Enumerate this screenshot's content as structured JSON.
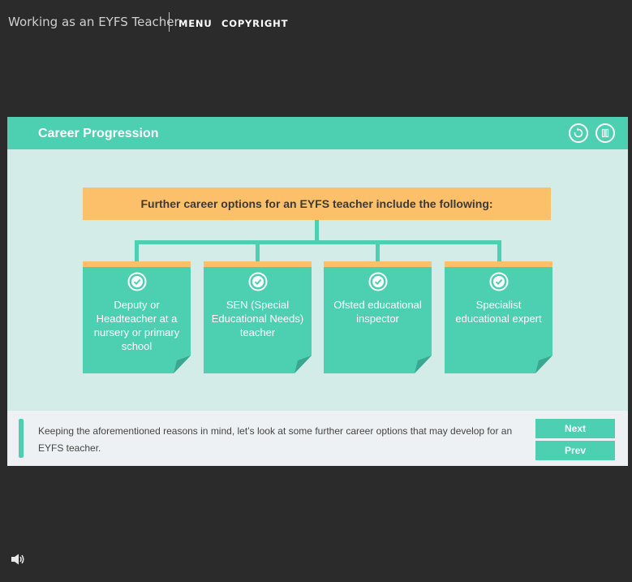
{
  "header": {
    "app_title": "Working as an EYFS Teacher",
    "menu_label": "MENU",
    "copyright_label": "COPYRIGHT"
  },
  "slide": {
    "title": "Career Progression",
    "controls": {
      "replay_icon": "replay-icon",
      "pause_icon": "pause-icon"
    },
    "main_box": "Further career options for an EYFS teacher include the following:",
    "cards": [
      {
        "label": "Deputy or\nHeadteacher at   a\nnursery or primary\nschool",
        "icon": "check-icon"
      },
      {
        "label": "SEN (Special\nEducational Needs)\nteacher",
        "icon": "check-icon"
      },
      {
        "label": "Ofsted educational\ninspector",
        "icon": "check-icon"
      },
      {
        "label": "Specialist\neducational expert",
        "icon": "check-icon"
      }
    ],
    "footer_text": "Keeping the aforementioned reasons in mind, let’s look at some further career options that may develop for an EYFS teacher.",
    "next_label": "Next",
    "prev_label": "Prev"
  },
  "audio": {
    "icon": "speaker-icon"
  },
  "colors": {
    "accent": "#4dcfb2",
    "highlight": "#fdc06a",
    "background": "#2b2b2b",
    "slide_bg": "#d3ece8"
  }
}
